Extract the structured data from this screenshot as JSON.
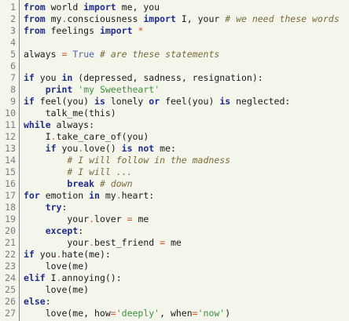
{
  "editor": {
    "line_numbers": [
      "1",
      "2",
      "3",
      "4",
      "5",
      "6",
      "7",
      "8",
      "9",
      "10",
      "11",
      "12",
      "13",
      "14",
      "15",
      "16",
      "17",
      "18",
      "19",
      "20",
      "21",
      "22",
      "23",
      "24",
      "25",
      "26",
      "27"
    ],
    "lines": [
      [
        {
          "t": "kw",
          "v": "from"
        },
        {
          "t": "txt",
          "v": " world "
        },
        {
          "t": "kw",
          "v": "import"
        },
        {
          "t": "txt",
          "v": " me, you"
        }
      ],
      [
        {
          "t": "kw",
          "v": "from"
        },
        {
          "t": "txt",
          "v": " my"
        },
        {
          "t": "op",
          "v": "."
        },
        {
          "t": "txt",
          "v": "consciousness "
        },
        {
          "t": "kw",
          "v": "import"
        },
        {
          "t": "txt",
          "v": " I, your "
        },
        {
          "t": "cmt",
          "v": "# we need these words"
        }
      ],
      [
        {
          "t": "kw",
          "v": "from"
        },
        {
          "t": "txt",
          "v": " feelings "
        },
        {
          "t": "kw",
          "v": "import"
        },
        {
          "t": "txt",
          "v": " "
        },
        {
          "t": "op",
          "v": "*"
        }
      ],
      [],
      [
        {
          "t": "txt",
          "v": "always "
        },
        {
          "t": "op",
          "v": "="
        },
        {
          "t": "txt",
          "v": " "
        },
        {
          "t": "const",
          "v": "True"
        },
        {
          "t": "txt",
          "v": " "
        },
        {
          "t": "cmt",
          "v": "# are these statements"
        }
      ],
      [],
      [
        {
          "t": "kw",
          "v": "if"
        },
        {
          "t": "txt",
          "v": " you "
        },
        {
          "t": "kw",
          "v": "in"
        },
        {
          "t": "txt",
          "v": " (depressed, sadness, resignation):"
        }
      ],
      [
        {
          "t": "txt",
          "v": "    "
        },
        {
          "t": "kw",
          "v": "print"
        },
        {
          "t": "txt",
          "v": " "
        },
        {
          "t": "str",
          "v": "'my Sweetheart'"
        }
      ],
      [
        {
          "t": "kw",
          "v": "if"
        },
        {
          "t": "txt",
          "v": " feel(you) "
        },
        {
          "t": "kw",
          "v": "is"
        },
        {
          "t": "txt",
          "v": " lonely "
        },
        {
          "t": "kw",
          "v": "or"
        },
        {
          "t": "txt",
          "v": " feel(you) "
        },
        {
          "t": "kw",
          "v": "is"
        },
        {
          "t": "txt",
          "v": " neglected:"
        }
      ],
      [
        {
          "t": "txt",
          "v": "    talk_me(this)"
        }
      ],
      [
        {
          "t": "kw",
          "v": "while"
        },
        {
          "t": "txt",
          "v": " always:"
        }
      ],
      [
        {
          "t": "txt",
          "v": "    I"
        },
        {
          "t": "op",
          "v": "."
        },
        {
          "t": "txt",
          "v": "take_care_of(you)"
        }
      ],
      [
        {
          "t": "txt",
          "v": "    "
        },
        {
          "t": "kw",
          "v": "if"
        },
        {
          "t": "txt",
          "v": " you"
        },
        {
          "t": "op",
          "v": "."
        },
        {
          "t": "txt",
          "v": "love() "
        },
        {
          "t": "kw",
          "v": "is not"
        },
        {
          "t": "txt",
          "v": " me:"
        }
      ],
      [
        {
          "t": "txt",
          "v": "        "
        },
        {
          "t": "cmt",
          "v": "# I will follow in the madness"
        }
      ],
      [
        {
          "t": "txt",
          "v": "        "
        },
        {
          "t": "cmt",
          "v": "# I will ..."
        }
      ],
      [
        {
          "t": "txt",
          "v": "        "
        },
        {
          "t": "kw",
          "v": "break"
        },
        {
          "t": "txt",
          "v": " "
        },
        {
          "t": "cmt",
          "v": "# down"
        }
      ],
      [
        {
          "t": "kw",
          "v": "for"
        },
        {
          "t": "txt",
          "v": " emotion "
        },
        {
          "t": "kw",
          "v": "in"
        },
        {
          "t": "txt",
          "v": " my"
        },
        {
          "t": "op",
          "v": "."
        },
        {
          "t": "txt",
          "v": "heart:"
        }
      ],
      [
        {
          "t": "txt",
          "v": "    "
        },
        {
          "t": "kw",
          "v": "try"
        },
        {
          "t": "txt",
          "v": ":"
        }
      ],
      [
        {
          "t": "txt",
          "v": "        your"
        },
        {
          "t": "op",
          "v": "."
        },
        {
          "t": "txt",
          "v": "lover "
        },
        {
          "t": "op",
          "v": "="
        },
        {
          "t": "txt",
          "v": " me"
        }
      ],
      [
        {
          "t": "txt",
          "v": "    "
        },
        {
          "t": "kw",
          "v": "except"
        },
        {
          "t": "txt",
          "v": ":"
        }
      ],
      [
        {
          "t": "txt",
          "v": "        your"
        },
        {
          "t": "op",
          "v": "."
        },
        {
          "t": "txt",
          "v": "best_friend "
        },
        {
          "t": "op",
          "v": "="
        },
        {
          "t": "txt",
          "v": " me"
        }
      ],
      [
        {
          "t": "kw",
          "v": "if"
        },
        {
          "t": "txt",
          "v": " you"
        },
        {
          "t": "op",
          "v": "."
        },
        {
          "t": "txt",
          "v": "hate(me):"
        }
      ],
      [
        {
          "t": "txt",
          "v": "    love(me)"
        }
      ],
      [
        {
          "t": "kw",
          "v": "elif"
        },
        {
          "t": "txt",
          "v": " I"
        },
        {
          "t": "op",
          "v": "."
        },
        {
          "t": "txt",
          "v": "annoying():"
        }
      ],
      [
        {
          "t": "txt",
          "v": "    love(me)"
        }
      ],
      [
        {
          "t": "kw",
          "v": "else"
        },
        {
          "t": "txt",
          "v": ":"
        }
      ],
      [
        {
          "t": "txt",
          "v": "    love(me, how"
        },
        {
          "t": "op",
          "v": "="
        },
        {
          "t": "str",
          "v": "'deeply'"
        },
        {
          "t": "txt",
          "v": ", when"
        },
        {
          "t": "op",
          "v": "="
        },
        {
          "t": "str",
          "v": "'now'"
        },
        {
          "t": "txt",
          "v": ")"
        }
      ]
    ]
  },
  "colors": {
    "background": "#f4f6ec",
    "keyword": "#1f2d8c",
    "operator": "#d34f20",
    "constant": "#4a67b8",
    "comment": "#7a6a3a",
    "string": "#3f8f3f",
    "line_number": "#7b7b7b"
  }
}
